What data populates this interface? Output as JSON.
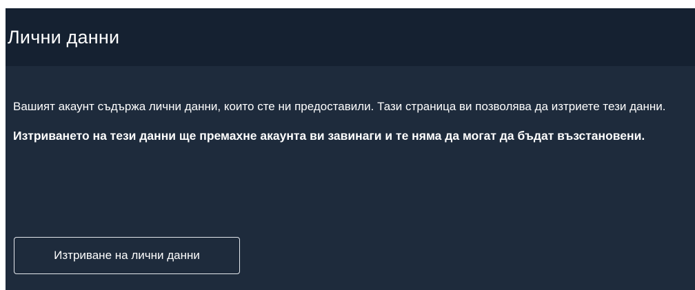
{
  "header": {
    "title": "Лични данни"
  },
  "body": {
    "intro": "Вашият акаунт съдържа лични данни, които сте ни предоставили. Тази страница ви позволява да изтриете тези данни.",
    "warning": "Изтриването на тези данни ще премахне акаунта ви завинаги и те няма да могат да бъдат възстановени."
  },
  "actions": {
    "delete_label": "Изтриване на лични данни"
  },
  "colors": {
    "header_bg": "#152131",
    "body_bg": "#1e2b3c",
    "text": "#ffffff"
  }
}
